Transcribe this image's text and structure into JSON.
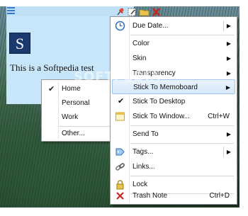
{
  "watermark": "SOFTPEDIA",
  "note": {
    "logo_letter": "S",
    "text": "This is a Softpedia test"
  },
  "submenu": {
    "items": [
      "Home",
      "Personal",
      "Work",
      "Other..."
    ],
    "checked_item": "Home"
  },
  "menu": {
    "due_date": "Due Date...",
    "color": "Color",
    "skin": "Skin",
    "transparency": "Transparency",
    "stick_to_memoboard": "Stick To Memoboard",
    "stick_to_desktop": "Stick To Desktop",
    "stick_to_window": "Stick To Window...",
    "stick_to_window_shortcut": "Ctrl+W",
    "send_to": "Send To",
    "tags": "Tags...",
    "links": "Links...",
    "lock": "Lock",
    "trash_note": "Trash Note",
    "trash_note_shortcut": "Ctrl+D",
    "arrow": "▶",
    "check": "✔"
  },
  "icons": {
    "note_menu": "menu-icon",
    "pin": "pin-icon",
    "edit": "edit-icon",
    "folder": "folder-icon",
    "close": "close-icon",
    "clock": "clock-icon",
    "window": "window-icon",
    "tag": "tag-icon",
    "link": "link-icon",
    "lock": "lock-icon",
    "trash": "trash-icon"
  },
  "colors": {
    "note_background": "#c7e6fa",
    "highlight": "#d6e8fa",
    "logo": "#1a3a6e"
  }
}
